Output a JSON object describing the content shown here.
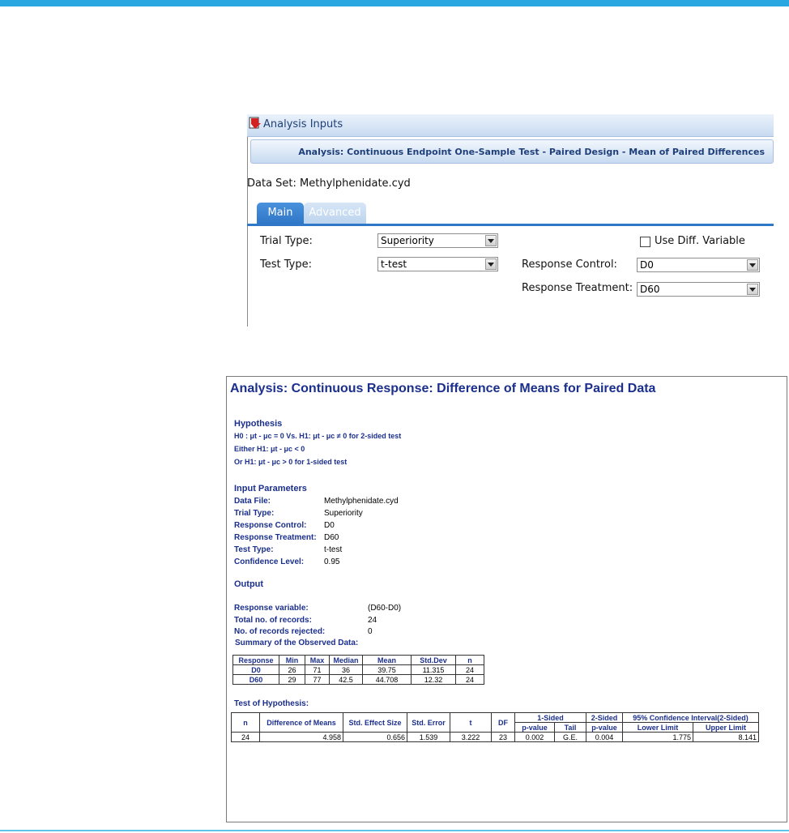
{
  "panel": {
    "title": "Analysis Inputs",
    "analysis_label": "Analysis: Continuous Endpoint One-Sample Test - Paired Design - Mean of Paired Differences",
    "dataset_label": "Data Set: Methylphenidate.cyd",
    "tabs": [
      {
        "label": "Main",
        "active": true
      },
      {
        "label": "Advanced",
        "active": false
      }
    ],
    "trial_type_label": "Trial Type:",
    "trial_type_value": "Superiority",
    "test_type_label": "Test Type:",
    "test_type_value": "t-test",
    "use_diff_label": "Use Diff. Variable",
    "response_control_label": "Response Control:",
    "response_control_value": "D0",
    "response_treatment_label": "Response Treatment:",
    "response_treatment_value": "D60",
    "accent_color": "#2f78c8"
  },
  "report": {
    "title": "Analysis: Continuous Response: Difference of Means for Paired Data",
    "hypothesis_heading": "Hypothesis",
    "hypothesis_lines": [
      "H0 : μt - μc = 0 Vs. H1: μt - μc ≠ 0 for 2-sided test",
      "Either H1: μt - μc < 0",
      "Or H1: μt - μc > 0 for 1-sided test"
    ],
    "input_heading": "Input Parameters",
    "inputs": [
      {
        "label": "Data File:",
        "value": "Methylphenidate.cyd"
      },
      {
        "label": "Trial Type:",
        "value": "Superiority"
      },
      {
        "label": "Response Control:",
        "value": "D0"
      },
      {
        "label": "Response Treatment:",
        "value": "D60"
      },
      {
        "label": "Test Type:",
        "value": "t-test"
      },
      {
        "label": "Confidence Level:",
        "value": "0.95"
      }
    ],
    "output_heading": "Output",
    "outputs": [
      {
        "label": "Response variable:",
        "value": "(D60-D0)"
      },
      {
        "label": "Total no. of records:",
        "value": "24"
      },
      {
        "label": "No. of records rejected:",
        "value": "0"
      }
    ],
    "summary_heading": "Summary of the Observed Data:",
    "summary_table": {
      "headers": [
        "Response",
        "Min",
        "Max",
        "Median",
        "Mean",
        "Std.Dev",
        "n"
      ],
      "rows": [
        [
          "D0",
          "26",
          "71",
          "36",
          "39.75",
          "11.315",
          "24"
        ],
        [
          "D60",
          "29",
          "77",
          "42.5",
          "44.708",
          "12.32",
          "24"
        ]
      ]
    },
    "test_heading": "Test of Hypothesis:",
    "test_table": {
      "headers": [
        "n",
        "Difference of Means",
        "Std. Effect Size",
        "Std. Error",
        "t",
        "DF"
      ],
      "group_one_sided": "1-Sided",
      "group_two_sided": "2-Sided",
      "group_ci": "95% Confidence Interval(2-Sided)",
      "sub_pvalue": "p-value",
      "sub_tail": "Tail",
      "sub_pvalue2": "p-value",
      "sub_lower": "Lower Limit",
      "sub_upper": "Upper Limit",
      "row": [
        "24",
        "4.958",
        "0.656",
        "1.539",
        "3.222",
        "23",
        "0.002",
        "G.E.",
        "0.004",
        "1.775",
        "8.141"
      ]
    }
  }
}
